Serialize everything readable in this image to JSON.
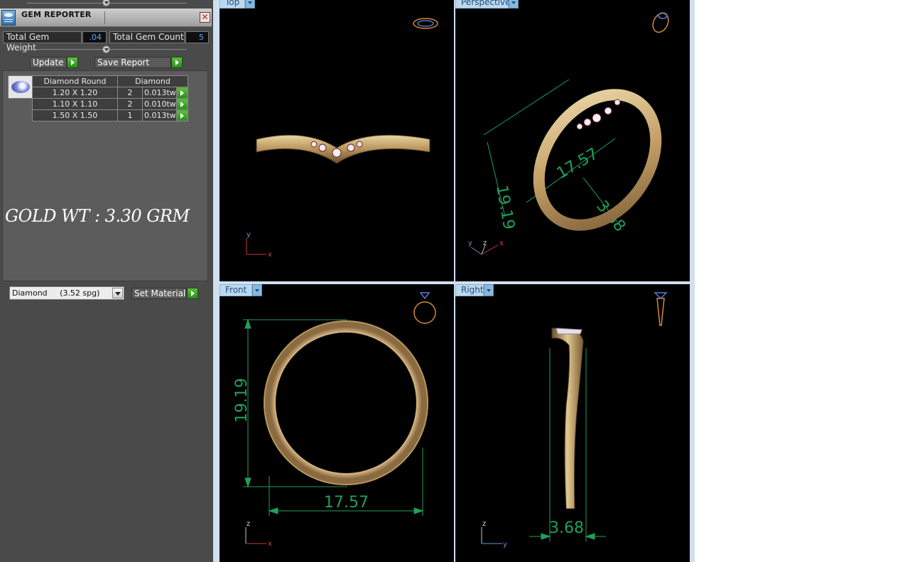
{
  "gem_reporter": {
    "title": "GEM REPORTER",
    "total_weight_label": "Total Gem Weight",
    "total_weight_value": ".04",
    "total_count_label": "Total Gem Count",
    "total_count_value": "5",
    "update_label": "Update",
    "save_report_label": "Save Report",
    "table": {
      "headers": [
        "Diamond Round",
        "Diamond"
      ],
      "rows": [
        {
          "size": "1.20 X 1.20",
          "count": "2",
          "weight": "0.013tw"
        },
        {
          "size": "1.10 X 1.10",
          "count": "2",
          "weight": "0.010tw"
        },
        {
          "size": "1.50 X 1.50",
          "count": "1",
          "weight": "0.013tw"
        }
      ]
    },
    "gold_note": "GOLD WT : 3.30 GRM",
    "material_select": "Diamond     (3.52 spg)",
    "set_material_label": "Set Material"
  },
  "viewports": {
    "top": {
      "label": "Top",
      "axes": [
        "y",
        "x"
      ]
    },
    "perspective": {
      "label": "Perspective",
      "axes": [
        "y",
        "z",
        "x"
      ],
      "dims": [
        "19.19",
        "17.57",
        "3.68"
      ]
    },
    "front": {
      "label": "Front",
      "axes": [
        "z",
        "x"
      ],
      "dims": [
        "19.19",
        "17.57"
      ]
    },
    "right": {
      "label": "Right",
      "axes": [
        "z",
        "y"
      ],
      "dims": [
        "3.68"
      ]
    }
  },
  "colors": {
    "panel_bg": "#4a4a4a",
    "viewport_bg": "#000000",
    "dimension_green": "#1fa05a",
    "gold": "#c9a96a",
    "value_blue": "#4fb0ff",
    "go_green": "#3fa52a"
  }
}
